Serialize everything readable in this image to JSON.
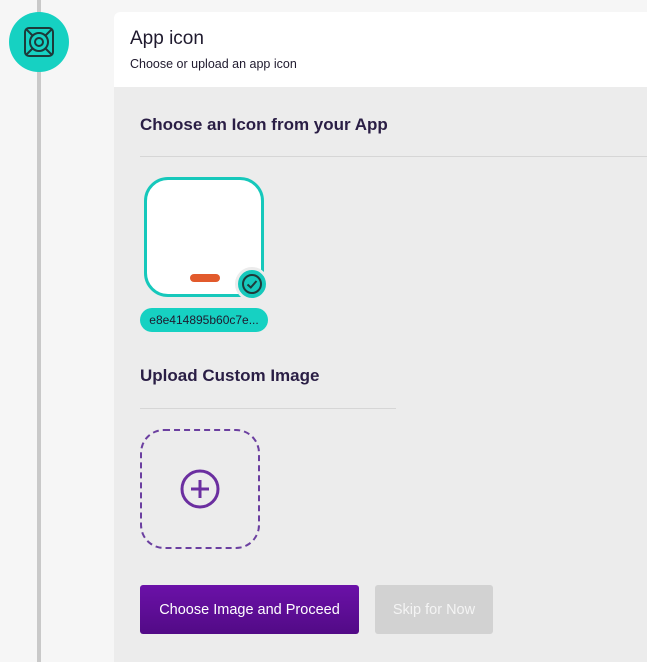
{
  "step": {
    "icon": "settings-icon",
    "color": "#16d1c2"
  },
  "card": {
    "title": "App icon",
    "subtitle": "Choose or upload an app icon"
  },
  "choose_section": {
    "title": "Choose an Icon from your App",
    "selected_icon": {
      "name": "e8e414895b60c7e...",
      "selected": true,
      "icon": "check-circle-icon"
    }
  },
  "upload_section": {
    "title": "Upload Custom Image",
    "icon": "plus-circle-icon"
  },
  "actions": {
    "primary_label": "Choose Image and Proceed",
    "skip_label": "Skip for Now"
  },
  "colors": {
    "accent": "#16c8bb",
    "primary": "#5f0e99",
    "upload_border": "#6b3fa0"
  }
}
